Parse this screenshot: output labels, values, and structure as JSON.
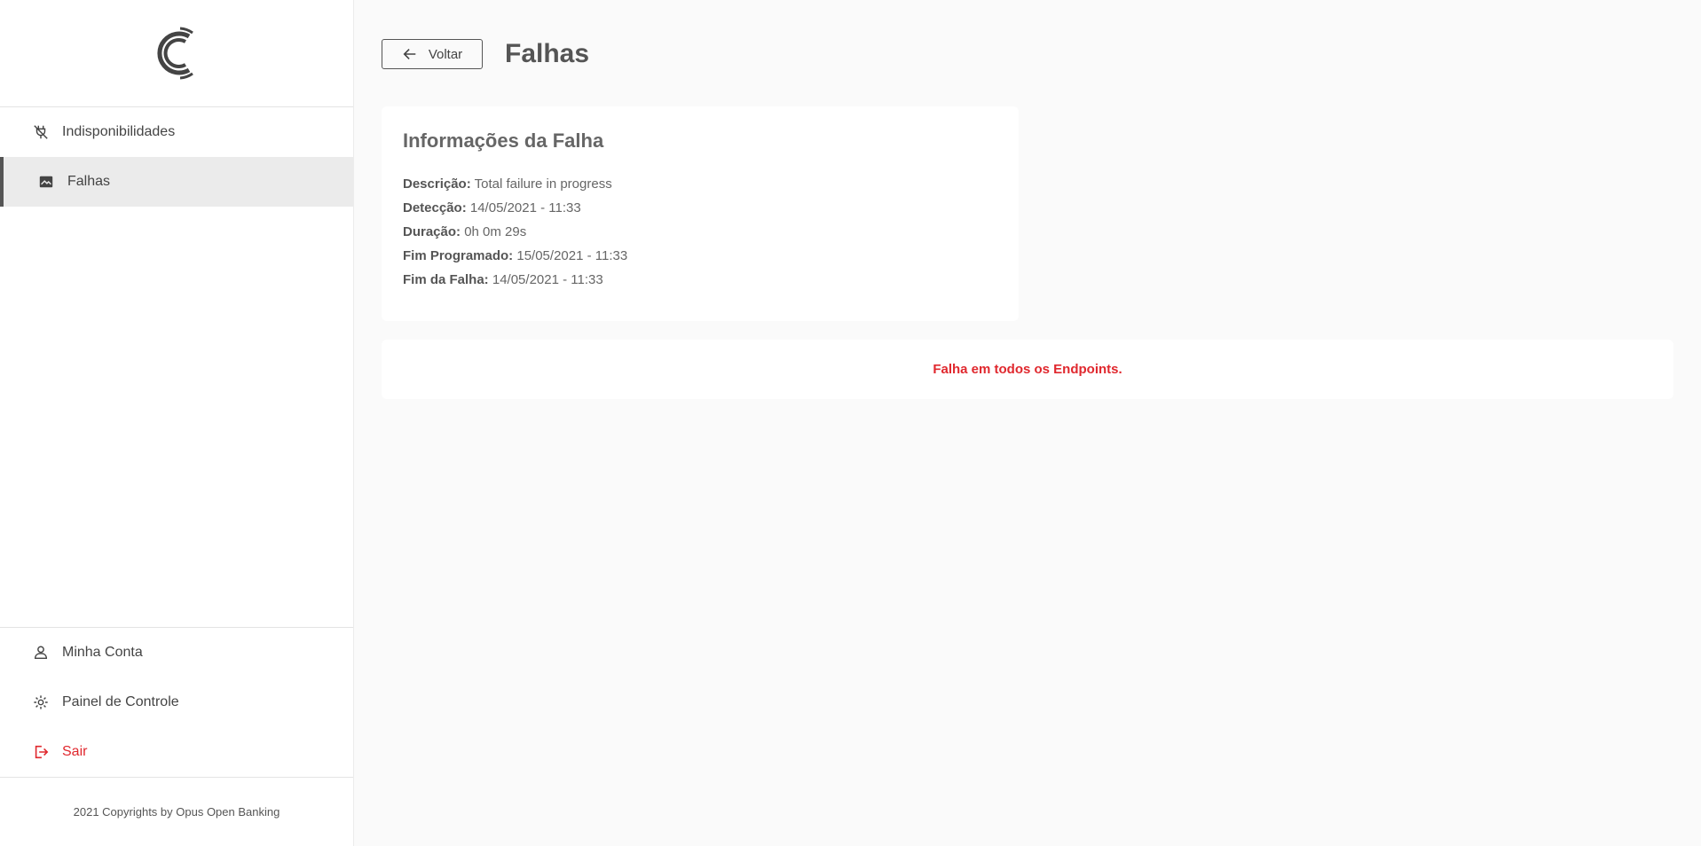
{
  "sidebar": {
    "logo_icon": "company-logo-icon",
    "nav_top": [
      {
        "label": "Indisponibilidades",
        "icon": "plug-off-icon"
      },
      {
        "label": "Falhas",
        "icon": "failure-image-icon"
      }
    ],
    "nav_bottom": [
      {
        "label": "Minha Conta",
        "icon": "user-icon"
      },
      {
        "label": "Painel de Controle",
        "icon": "gear-icon"
      },
      {
        "label": "Sair",
        "icon": "logout-icon"
      }
    ],
    "footer": "2021 Copyrights by Opus Open Banking"
  },
  "header": {
    "back_label": "Voltar",
    "title": "Falhas"
  },
  "info": {
    "title": "Informações da Falha",
    "rows": [
      {
        "label": "Descrição:",
        "value": "Total failure in progress"
      },
      {
        "label": "Detecção:",
        "value": "14/05/2021 - 11:33"
      },
      {
        "label": "Duração:",
        "value": "0h 0m 29s"
      },
      {
        "label": "Fim Programado:",
        "value": "15/05/2021 - 11:33"
      },
      {
        "label": "Fim da Falha:",
        "value": "14/05/2021 - 11:33"
      }
    ]
  },
  "alert": {
    "message": "Falha em todos os Endpoints."
  },
  "colors": {
    "accent_red": "#e0282e",
    "text": "#555555",
    "active_bg": "#ebebeb"
  }
}
